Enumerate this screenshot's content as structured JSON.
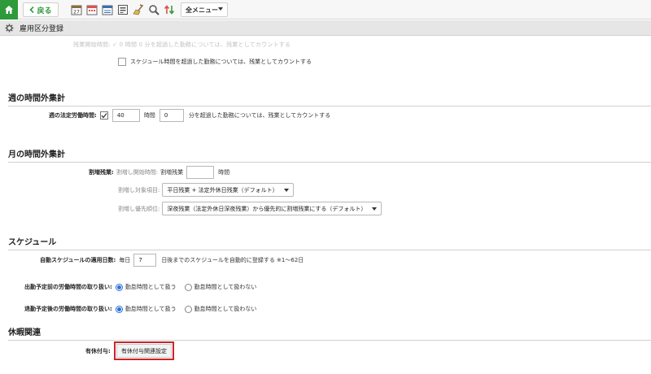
{
  "toolbar": {
    "back_label": "戻る",
    "menu_label": "全メニュー",
    "icons": [
      "calendar-icon",
      "schedule-icon",
      "timesheet-icon",
      "card-icon",
      "broom-icon",
      "search-icon",
      "sort-icon"
    ]
  },
  "page": {
    "title": "雇用区分登録"
  },
  "faded_row": {
    "text": "残業開始時間:  ✓  0      時間  0      分を超過した勤務については、残業としてカウントする"
  },
  "schedule_overtime": {
    "label": "スケジュール時間を超過した勤務については、残業としてカウントする"
  },
  "weekly": {
    "heading": "週の時間外集計",
    "label": "週の法定労働時間:",
    "hours": "40",
    "hours_unit": "時間",
    "minutes": "0",
    "suffix": "分を超過した勤務については、残業としてカウントする"
  },
  "monthly": {
    "heading": "月の時間外集計",
    "label": "割増残業:",
    "start_label": "割増し開始時間:",
    "start_prefix": "割増残業",
    "start_value": "",
    "start_unit": "時間",
    "target_label": "割増し対象項目:",
    "target_value": "平日残業 + 法定外休日残業（デフォルト）",
    "priority_label": "割増し優先順位:",
    "priority_value": "深夜残業（法定外休日深夜残業）から優先的に割増残業にする（デフォルト）"
  },
  "schedule": {
    "heading": "スケジュール",
    "auto_label": "自動スケジュールの適用日数:",
    "auto_prefix": "毎日",
    "auto_value": "7",
    "auto_suffix": "日後までのスケジュールを自動的に登録する ※1〜62日",
    "before_label": "出勤予定前の労働時間の取り扱い:",
    "after_label": "退勤予定後の労働時間の取り扱い:",
    "opt_rest": "勤怠時間として扱う",
    "opt_none": "勤怠時間として扱わない"
  },
  "leave": {
    "heading": "休暇関連",
    "label": "有休付与:",
    "button": "有休付与関連設定"
  },
  "colors": {
    "brand": "#2e9a3a",
    "highlight": "#c8262a",
    "radio": "#2a6fd6"
  }
}
